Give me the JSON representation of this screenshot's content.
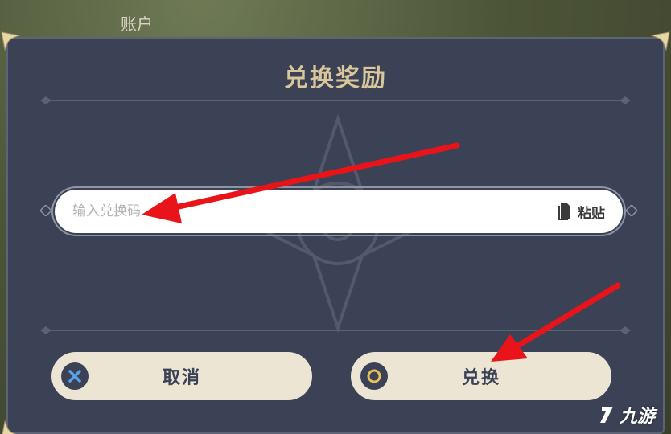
{
  "background": {
    "label": "账户"
  },
  "dialog": {
    "title": "兑换奖励",
    "code_input": {
      "placeholder": "输入兑换码",
      "value": ""
    },
    "paste_label": "粘贴",
    "cancel_label": "取消",
    "redeem_label": "兑换"
  },
  "watermark": {
    "text": "九游"
  },
  "colors": {
    "dialog_bg": "#3b4255",
    "title_gold": "#d9c79b",
    "button_bg": "#ece5d4",
    "cancel_icon": "#5aa0e6",
    "confirm_icon": "#e6c15a",
    "arrow": "#e8141a"
  },
  "icons": [
    "paste-icon",
    "cancel-x-icon",
    "confirm-circle-icon",
    "corner-ornament-icon",
    "logo-icon"
  ]
}
